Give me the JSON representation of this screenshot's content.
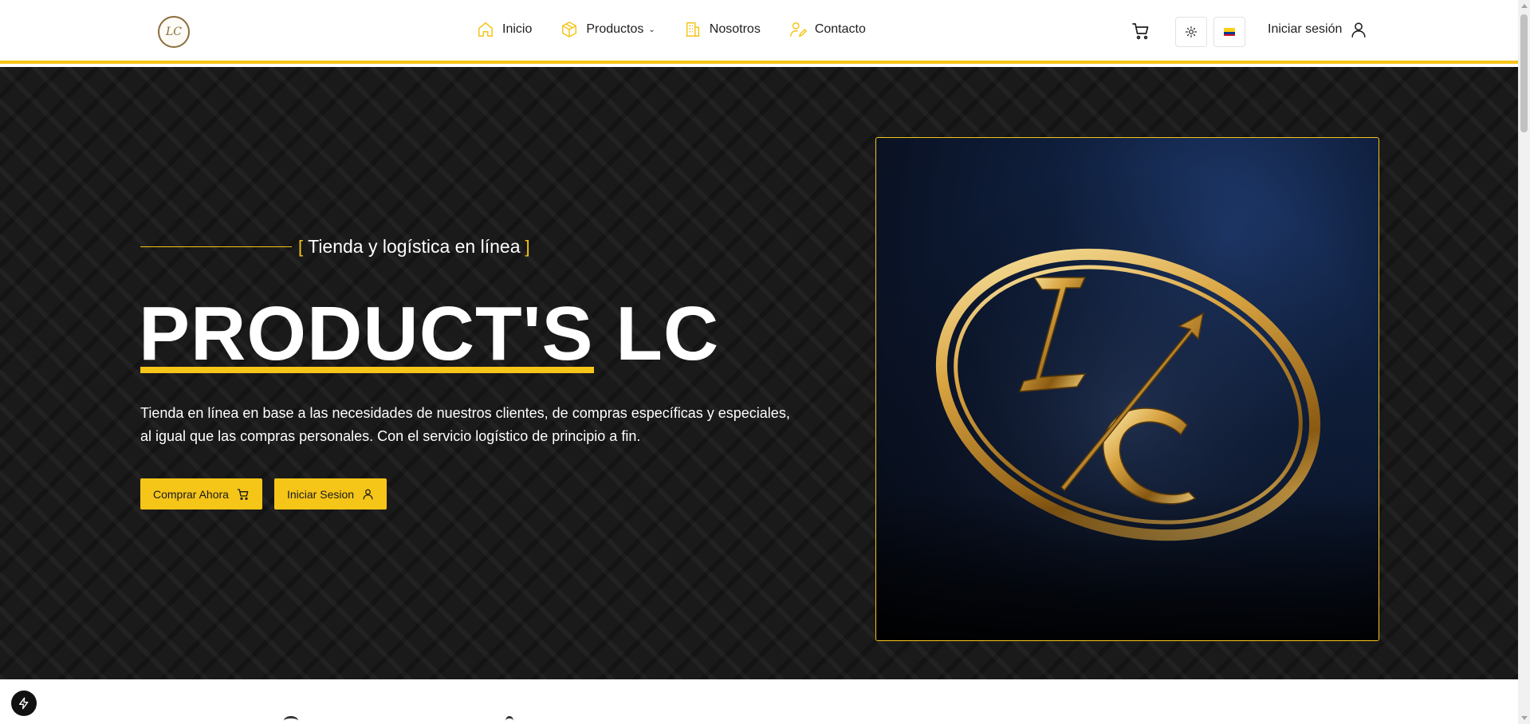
{
  "header": {
    "logo_text": "LC",
    "nav": [
      {
        "label": "Inicio",
        "icon": "home-icon"
      },
      {
        "label": "Productos",
        "icon": "box-icon",
        "has_dropdown": true
      },
      {
        "label": "Nosotros",
        "icon": "building-icon"
      },
      {
        "label": "Contacto",
        "icon": "user-contact-icon"
      }
    ],
    "login_label": "Iniciar sesión",
    "language_flag": "Colombia"
  },
  "hero": {
    "tagline_open": "[",
    "tagline": "Tienda y logística en línea",
    "tagline_close": "]",
    "title_underlined": "PRODUCT'S",
    "title_rest": " LC",
    "description": "Tienda en línea en base a las necesidades de nuestros clientes, de compras específicas y especiales, al igual que las compras personales. Con el servicio logístico de principio a fin.",
    "buy_button": "Comprar Ahora",
    "login_button": "Iniciar Sesion",
    "image_alt": "LC logo"
  },
  "colors": {
    "accent": "#f5c518",
    "hero_bg": "#1a1a1a",
    "text_dark": "#1f1f1f"
  }
}
